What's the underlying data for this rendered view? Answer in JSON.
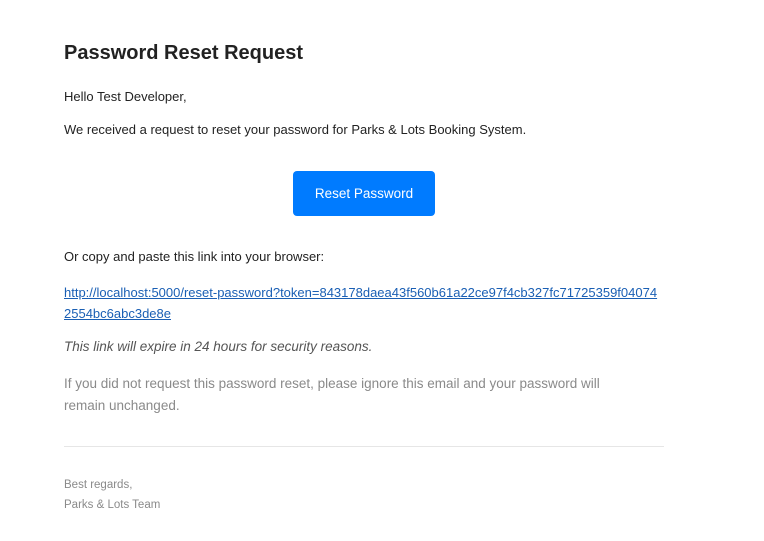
{
  "email": {
    "title": "Password Reset Request",
    "greeting": "Hello Test Developer,",
    "intro": "We received a request to reset your password for Parks & Lots Booking System.",
    "button_label": "Reset Password",
    "copy_instruction": "Or copy and paste this link into your browser:",
    "reset_link": "http://localhost:5000/reset-password?token=843178daea43f560b61a22ce97f4cb327fc71725359f040742554bc6abc3de8e",
    "expiry_note": "This link will expire in 24 hours for security reasons.",
    "ignore_note": "If you did not request this password reset, please ignore this email and your password will remain unchanged.",
    "signoff": "Best regards,",
    "team": "Parks & Lots Team"
  },
  "colors": {
    "button_background": "#007bff",
    "link": "#1a5fb4",
    "muted_text": "#8a8a8a"
  }
}
